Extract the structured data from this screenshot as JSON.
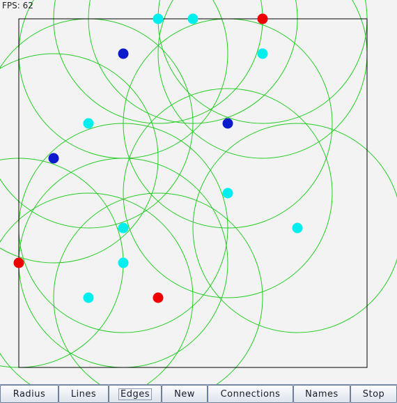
{
  "fps_text": "FPS: 62",
  "toolbar": {
    "buttons": [
      {
        "label": "Radius"
      },
      {
        "label": "Lines"
      },
      {
        "label": "Edges",
        "focused": true
      },
      {
        "label": "New"
      },
      {
        "label": "Connections"
      },
      {
        "label": "Names"
      },
      {
        "label": "Stop"
      }
    ]
  },
  "colors": {
    "background": "#f3f3f3",
    "circle": "#22cc22",
    "boundary": "#000000",
    "node_cyan": "#00eeee",
    "node_blue": "#0a1acc",
    "node_red": "#ee0000"
  }
}
